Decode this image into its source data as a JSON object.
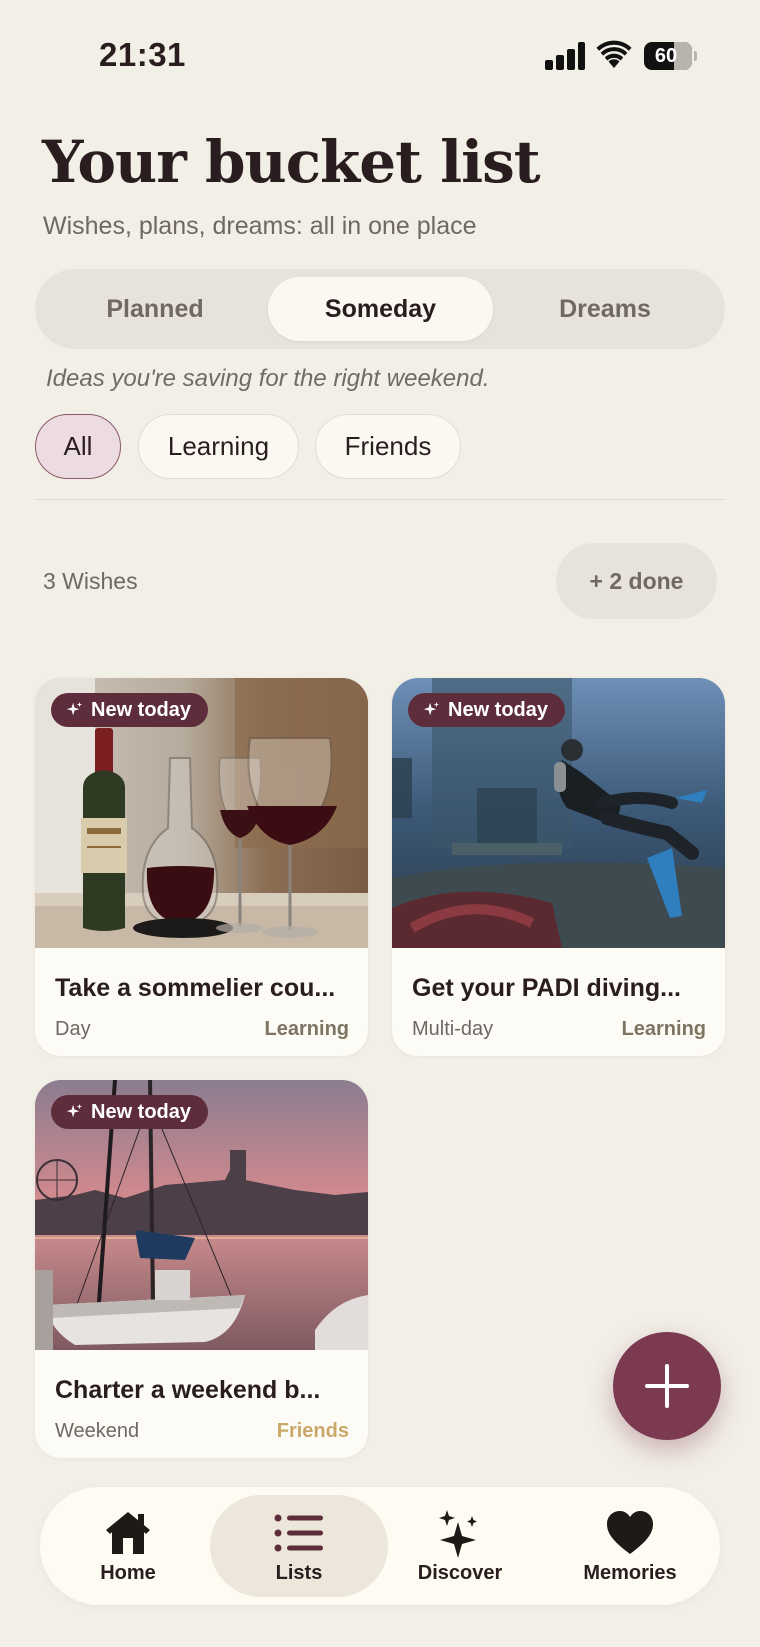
{
  "status_bar": {
    "time": "21:31",
    "battery": "60"
  },
  "header": {
    "title": "Your bucket list",
    "subtitle": "Wishes, plans, dreams: all in one place"
  },
  "segments": {
    "items": [
      {
        "label": "Planned",
        "active": false
      },
      {
        "label": "Someday",
        "active": true
      },
      {
        "label": "Dreams",
        "active": false
      }
    ],
    "helper": "Ideas you're saving for the right weekend."
  },
  "filters": [
    {
      "label": "All",
      "active": true
    },
    {
      "label": "Learning",
      "active": false
    },
    {
      "label": "Friends",
      "active": false
    }
  ],
  "summary": {
    "count": "3 Wishes",
    "done": "+ 2 done"
  },
  "cards": [
    {
      "badge": "New today",
      "title": "Take a sommelier cou...",
      "duration": "Day",
      "category": "Learning",
      "category_color": "#7d7462"
    },
    {
      "badge": "New today",
      "title": "Get your PADI diving...",
      "duration": "Multi-day",
      "category": "Learning",
      "category_color": "#7d7462"
    },
    {
      "badge": "New today",
      "title": "Charter a weekend b...",
      "duration": "Weekend",
      "category": "Friends",
      "category_color": "#c9a86a"
    }
  ],
  "fab": {
    "icon": "plus-icon"
  },
  "nav": [
    {
      "label": "Home",
      "icon": "home-icon",
      "active": false
    },
    {
      "label": "Lists",
      "icon": "list-icon",
      "active": true
    },
    {
      "label": "Discover",
      "icon": "sparkles-icon",
      "active": false
    },
    {
      "label": "Memories",
      "icon": "heart-icon",
      "active": false
    }
  ],
  "colors": {
    "background": "#f2efe7",
    "accent": "#7b3a50",
    "badge": "#5e2d3c",
    "chip_active": "#ecdbe0"
  }
}
